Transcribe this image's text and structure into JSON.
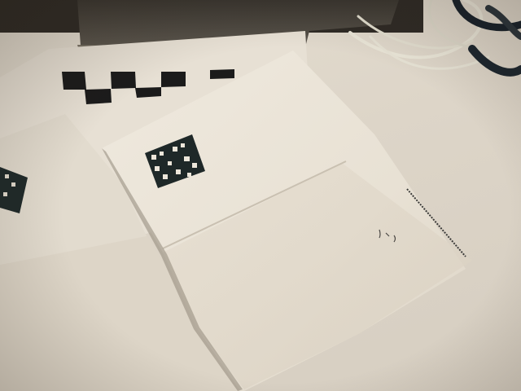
{
  "scene": {
    "description_label": "",
    "colors": {
      "table_surface": "#ddd5c8",
      "paper": "#ece6da",
      "paper_shadow": "#cfc6b8",
      "marker_dark": "#1f2a2a",
      "laptop_body": "#5a554c",
      "cable": "#e8e4d6"
    },
    "icons": [
      "fiducial-marker-icon",
      "checkerboard-icon"
    ]
  }
}
